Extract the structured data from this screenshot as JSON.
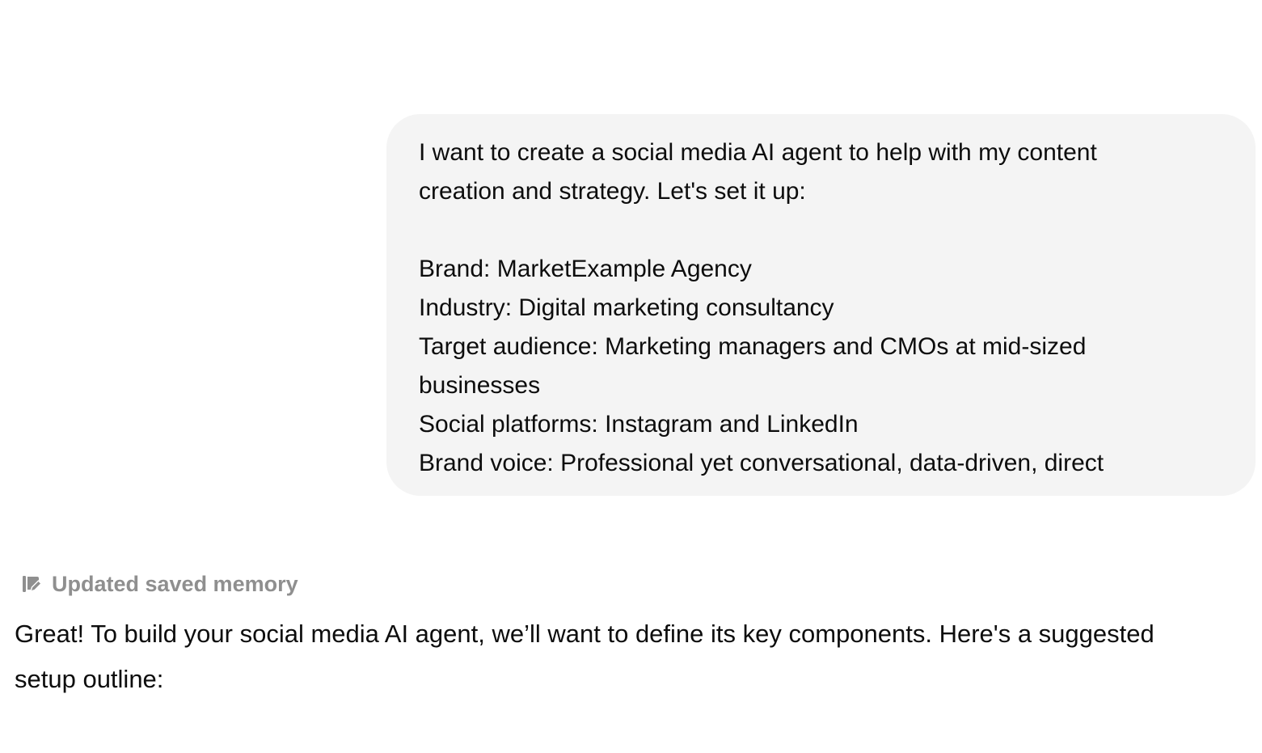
{
  "user_message": {
    "lines": [
      "I want to create a social media AI agent to help with my content",
      "creation and strategy. Let's set it up:",
      "",
      "Brand: MarketExample Agency",
      "Industry: Digital marketing consultancy",
      "Target audience: Marketing managers and CMOs at mid-sized",
      "businesses",
      "Social platforms: Instagram and LinkedIn",
      "Brand voice: Professional yet conversational, data-driven, direct"
    ]
  },
  "memory_status": {
    "icon": "memory-update-icon",
    "label": "Updated saved memory"
  },
  "assistant_message": {
    "lines": [
      "Great! To build your social media AI agent, we’ll want to define its key components. Here's a suggested",
      "setup outline:"
    ]
  },
  "colors": {
    "user_bubble_bg": "#f4f4f4",
    "muted_text": "#8f8f8f",
    "body_text": "#0d0d0d"
  }
}
